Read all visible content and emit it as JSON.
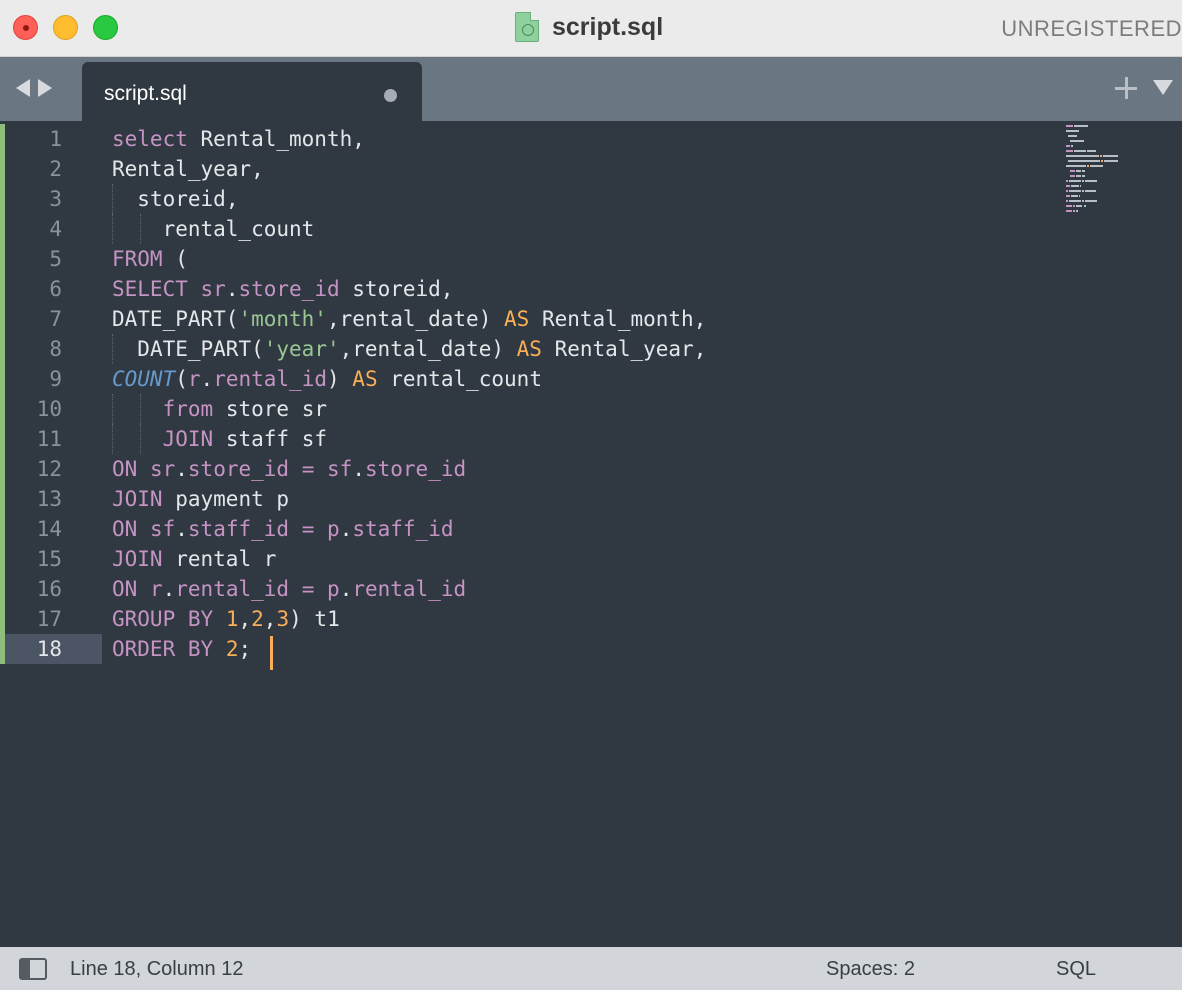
{
  "window": {
    "title": "script.sql",
    "unregistered": "UNREGISTERED"
  },
  "tabs": [
    {
      "label": "script.sql",
      "dirty": true
    }
  ],
  "editor": {
    "line_numbers": [
      "1",
      "2",
      "3",
      "4",
      "5",
      "6",
      "7",
      "8",
      "9",
      "10",
      "11",
      "12",
      "13",
      "14",
      "15",
      "16",
      "17",
      "18"
    ],
    "active_line": "18",
    "lines": [
      "select Rental_month,",
      "Rental_year,",
      "  storeid,",
      "    rental_count",
      "FROM (",
      "SELECT sr.store_id storeid,",
      "DATE_PART('month',rental_date) AS Rental_month,",
      "  DATE_PART('year',rental_date) AS Rental_year,",
      "COUNT(r.rental_id) AS rental_count",
      "    from store sr",
      "    JOIN staff sf",
      "ON sr.store_id = sf.store_id",
      "JOIN payment p",
      "ON sf.staff_id = p.staff_id",
      "JOIN rental r",
      "ON r.rental_id = p.rental_id",
      "GROUP BY 1,2,3) t1",
      "ORDER BY 2;"
    ]
  },
  "status": {
    "position": "Line 18, Column 12",
    "indentation": "Spaces: 2",
    "syntax": "SQL"
  },
  "colors": {
    "background": "#303841",
    "keyword": "#c594c5",
    "accent_orange": "#f9ae58",
    "string": "#99c794",
    "function": "#6699cc"
  }
}
